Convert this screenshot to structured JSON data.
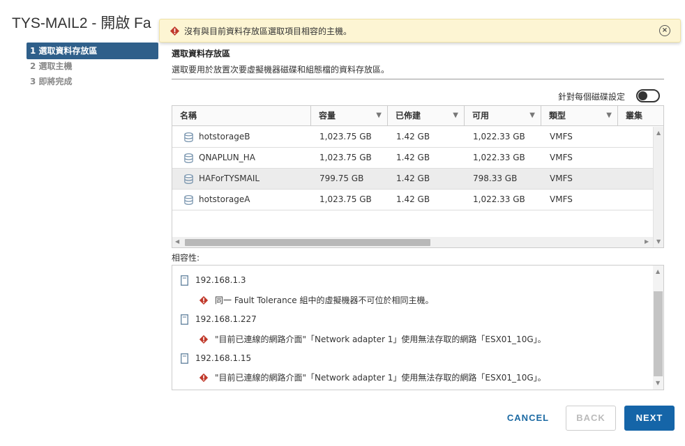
{
  "window": {
    "title": "TYS-MAIL2 - 開啟 Fa"
  },
  "banner": {
    "message": "沒有與目前資料存放區選取項目相容的主機。"
  },
  "steps": [
    {
      "label": "1 選取資料存放區",
      "active": true
    },
    {
      "label": "2 選取主機",
      "active": false
    },
    {
      "label": "3 即將完成",
      "active": false
    }
  ],
  "section": {
    "title": "選取資料存放區",
    "description": "選取要用於放置次要虛擬機器磁碟和組態檔的資料存放區。"
  },
  "per_disk_toggle": {
    "label": "針對每個磁碟設定",
    "on": false
  },
  "table": {
    "columns": [
      "名稱",
      "容量",
      "已佈建",
      "可用",
      "類型",
      "叢集"
    ],
    "rows": [
      {
        "name": "hotstorageB",
        "capacity": "1,023.75 GB",
        "provisioned": "1.42 GB",
        "free": "1,022.33 GB",
        "type": "VMFS",
        "selected": false
      },
      {
        "name": "QNAPLUN_HA",
        "capacity": "1,023.75 GB",
        "provisioned": "1.42 GB",
        "free": "1,022.33 GB",
        "type": "VMFS",
        "selected": false
      },
      {
        "name": "HAForTYSMAIL",
        "capacity": "799.75 GB",
        "provisioned": "1.42 GB",
        "free": "798.33 GB",
        "type": "VMFS",
        "selected": true
      },
      {
        "name": "hotstorageA",
        "capacity": "1,023.75 GB",
        "provisioned": "1.42 GB",
        "free": "1,022.33 GB",
        "type": "VMFS",
        "selected": false
      }
    ]
  },
  "compatibility": {
    "label": "相容性:",
    "hosts": [
      {
        "host": "192.168.1.3",
        "message": "同一 Fault Tolerance 組中的虛擬機器不可位於相同主機。"
      },
      {
        "host": "192.168.1.227",
        "message": "\"目前已連線的網路介面\"「Network adapter 1」使用無法存取的網路「ESX01_10G」。"
      },
      {
        "host": "192.168.1.15",
        "message": "\"目前已連線的網路介面\"「Network adapter 1」使用無法存取的網路「ESX01_10G」。"
      }
    ]
  },
  "buttons": {
    "cancel": "CANCEL",
    "back": "BACK",
    "next": "NEXT"
  },
  "colors": {
    "accent": "#1565a8",
    "active_step": "#2f5f8a",
    "warning": "#c0392b",
    "banner_bg": "#fdf5d3"
  }
}
